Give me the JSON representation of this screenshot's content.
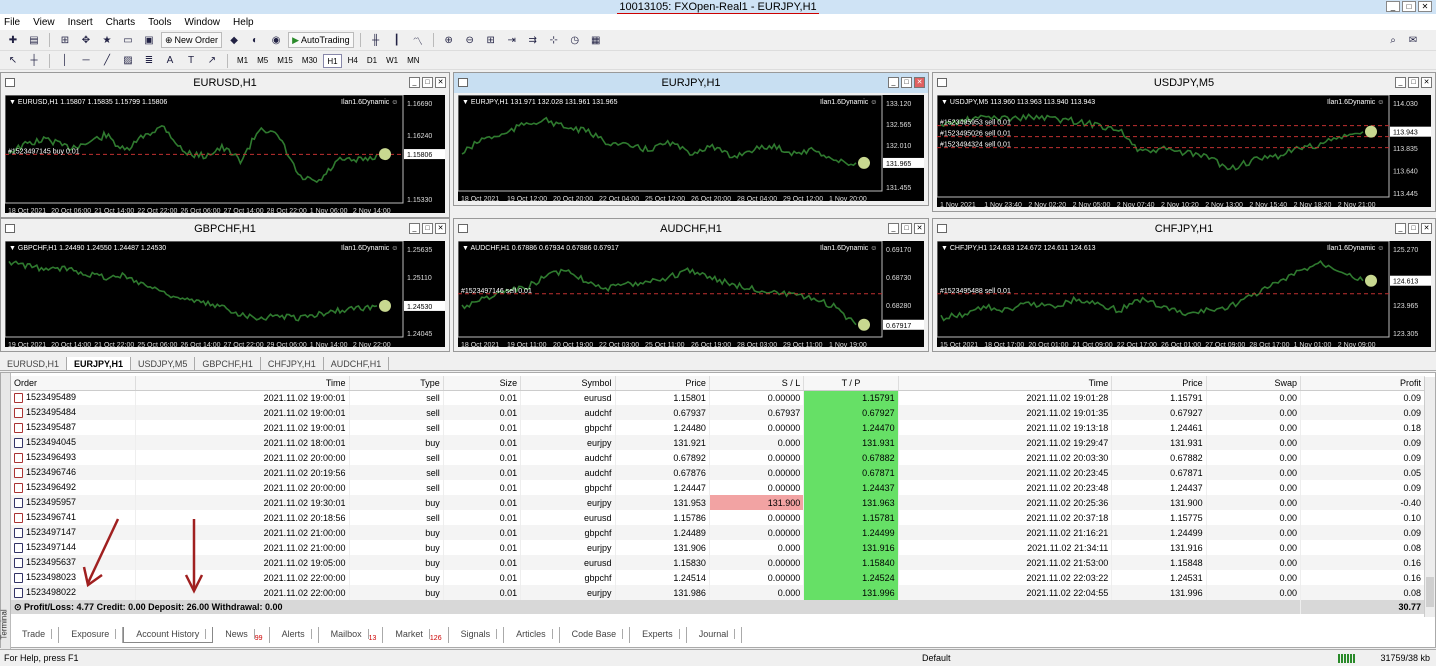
{
  "window": {
    "title": "10013105: FXOpen-Real1 - EURJPY,H1"
  },
  "menu": [
    "File",
    "View",
    "Insert",
    "Charts",
    "Tools",
    "Window",
    "Help"
  ],
  "toolbar": {
    "new_order": "New Order",
    "autotrading": "AutoTrading"
  },
  "timeframes": [
    "M1",
    "M5",
    "M15",
    "M30",
    "H1",
    "H4",
    "D1",
    "W1",
    "MN"
  ],
  "active_timeframe": "H1",
  "charts": [
    {
      "title": "EURUSD,H1",
      "info": "EURUSD,H1  1.15807 1.15835 1.15799 1.15806",
      "ea": "Ilan1.6Dynamic",
      "prices": [
        "1.16690",
        "1.16240",
        "1.15806",
        "1.15330"
      ],
      "current": "1.15806",
      "order_lines": [
        "#1523497145 buy 0.01"
      ],
      "dates": [
        "18 Oct 2021",
        "20 Oct 06:00",
        "21 Oct 14:00",
        "22 Oct 22:00",
        "26 Oct 06:00",
        "27 Oct 14:00",
        "28 Oct 22:00",
        "1 Nov 06:00",
        "2 Nov 14:00"
      ],
      "color": "#2f7a2f",
      "trend": [
        0.5,
        0.4,
        0.35,
        0.45,
        0.4,
        0.3,
        0.5,
        0.3,
        0.2,
        0.5,
        0.55,
        0.45,
        0.6,
        0.2,
        0.35,
        0.8,
        0.85,
        0.6,
        0.6,
        0.55
      ],
      "active": false
    },
    {
      "title": "EURJPY,H1",
      "info": "EURJPY,H1  131.971 132.028 131.961 131.965",
      "ea": "Ilan1.6Dynamic",
      "prices": [
        "133.120",
        "132.565",
        "132.010",
        "131.965",
        "131.455"
      ],
      "current": "131.965",
      "order_lines": [],
      "dates": [
        "18 Oct 2021",
        "19 Oct 12:00",
        "20 Oct 20:00",
        "22 Oct 04:00",
        "25 Oct 12:00",
        "26 Oct 20:00",
        "28 Oct 04:00",
        "29 Oct 12:00",
        "1 Nov 20:00"
      ],
      "color": "#2f7a2f",
      "trend": [
        0.6,
        0.4,
        0.35,
        0.2,
        0.15,
        0.25,
        0.3,
        0.45,
        0.5,
        0.55,
        0.45,
        0.6,
        0.5,
        0.65,
        0.55,
        0.5,
        0.6,
        0.55,
        0.7,
        0.75
      ],
      "active": true
    },
    {
      "title": "USDJPY,M5",
      "info": "USDJPY,M5  113.960 113.963 113.940 113.943",
      "ea": "Ilan1.6Dynamic",
      "prices": [
        "114.030",
        "113.943",
        "113.835",
        "113.640",
        "113.445"
      ],
      "current": "113.943",
      "order_lines": [
        "#1523495953 sell 0.01",
        "#1523495026 sell 0.01",
        "#1523494324 sell 0.01"
      ],
      "dates": [
        "1 Nov 2021",
        "1 Nov 23:40",
        "2 Nov 02:20",
        "2 Nov 05:00",
        "2 Nov 07:40",
        "2 Nov 10:20",
        "2 Nov 13:00",
        "2 Nov 15:40",
        "2 Nov 18:20",
        "2 Nov 21:00"
      ],
      "color": "#2f7a2f",
      "trend": [
        0.2,
        0.15,
        0.1,
        0.12,
        0.1,
        0.12,
        0.15,
        0.2,
        0.25,
        0.55,
        0.5,
        0.55,
        0.6,
        0.75,
        0.65,
        0.6,
        0.5,
        0.45,
        0.35,
        0.3
      ],
      "active": false
    },
    {
      "title": "GBPCHF,H1",
      "info": "GBPCHF,H1  1.24490 1.24550 1.24487 1.24530",
      "ea": "Ilan1.6Dynamic",
      "prices": [
        "1.25635",
        "1.25110",
        "1.24530",
        "1.24045"
      ],
      "current": "1.24530",
      "order_lines": [],
      "dates": [
        "19 Oct 2021",
        "20 Oct 14:00",
        "21 Oct 22:00",
        "25 Oct 06:00",
        "26 Oct 14:00",
        "27 Oct 22:00",
        "29 Oct 06:00",
        "1 Nov 14:00",
        "2 Nov 22:00"
      ],
      "color": "#2f7a2f",
      "trend": [
        0.1,
        0.15,
        0.2,
        0.18,
        0.25,
        0.3,
        0.28,
        0.4,
        0.5,
        0.6,
        0.65,
        0.7,
        0.8,
        0.85,
        0.82,
        0.85,
        0.8,
        0.75,
        0.72,
        0.7
      ],
      "active": false
    },
    {
      "title": "AUDCHF,H1",
      "info": "AUDCHF,H1  0.67886 0.67934 0.67886 0.67917",
      "ea": "Ilan1.6Dynamic",
      "prices": [
        "0.69170",
        "0.68730",
        "0.68280",
        "0.67917"
      ],
      "current": "0.67917",
      "order_lines": [
        "#1523497146 sell 0.01"
      ],
      "dates": [
        "18 Oct 2021",
        "19 Oct 11:00",
        "20 Oct 19:00",
        "22 Oct 03:00",
        "25 Oct 11:00",
        "26 Oct 19:00",
        "28 Oct 03:00",
        "29 Oct 11:00",
        "1 Nov 19:00"
      ],
      "color": "#2f7a2f",
      "trend": [
        0.7,
        0.6,
        0.5,
        0.45,
        0.3,
        0.2,
        0.35,
        0.45,
        0.4,
        0.35,
        0.3,
        0.2,
        0.3,
        0.4,
        0.45,
        0.5,
        0.55,
        0.6,
        0.7,
        0.95
      ],
      "active": false
    },
    {
      "title": "CHFJPY,H1",
      "info": "CHFJPY,H1  124.633 124.672 124.611 124.613",
      "ea": "Ilan1.6Dynamic",
      "prices": [
        "125.270",
        "124.613",
        "123.965",
        "123.305"
      ],
      "current": "124.613",
      "order_lines": [
        "#1523495488 sell 0.01"
      ],
      "dates": [
        "15 Oct 2021",
        "18 Oct 17:00",
        "20 Oct 01:00",
        "21 Oct 09:00",
        "22 Oct 17:00",
        "26 Oct 01:00",
        "27 Oct 09:00",
        "28 Oct 17:00",
        "1 Nov 01:00",
        "2 Nov 09:00"
      ],
      "color": "#2f7a2f",
      "trend": [
        0.85,
        0.8,
        0.7,
        0.75,
        0.65,
        0.7,
        0.6,
        0.65,
        0.75,
        0.6,
        0.7,
        0.8,
        0.75,
        0.7,
        0.55,
        0.4,
        0.25,
        0.1,
        0.2,
        0.35
      ],
      "active": false
    }
  ],
  "chart_tabs": [
    "EURUSD,H1",
    "EURJPY,H1",
    "USDJPY,M5",
    "GBPCHF,H1",
    "CHFJPY,H1",
    "AUDCHF,H1"
  ],
  "active_chart_tab": "EURJPY,H1",
  "table": {
    "headers": [
      "Order",
      "Time",
      "Type",
      "Size",
      "Symbol",
      "Price",
      "S / L",
      "T / P",
      "Time",
      "Price",
      "Swap",
      "Profit"
    ],
    "rows": [
      [
        "1523495489",
        "2021.11.02 19:00:01",
        "sell",
        "0.01",
        "eurusd",
        "1.15801",
        "0.00000",
        "1.15791",
        "2021.11.02 19:01:28",
        "1.15791",
        "0.00",
        "0.09"
      ],
      [
        "1523495484",
        "2021.11.02 19:00:01",
        "sell",
        "0.01",
        "audchf",
        "0.67937",
        "0.67937",
        "0.67927",
        "2021.11.02 19:01:35",
        "0.67927",
        "0.00",
        "0.09"
      ],
      [
        "1523495487",
        "2021.11.02 19:00:01",
        "sell",
        "0.01",
        "gbpchf",
        "1.24480",
        "0.00000",
        "1.24470",
        "2021.11.02 19:13:18",
        "1.24461",
        "0.00",
        "0.18"
      ],
      [
        "1523494045",
        "2021.11.02 18:00:01",
        "buy",
        "0.01",
        "eurjpy",
        "131.921",
        "0.000",
        "131.931",
        "2021.11.02 19:29:47",
        "131.931",
        "0.00",
        "0.09"
      ],
      [
        "1523496493",
        "2021.11.02 20:00:00",
        "sell",
        "0.01",
        "audchf",
        "0.67892",
        "0.00000",
        "0.67882",
        "2021.11.02 20:03:30",
        "0.67882",
        "0.00",
        "0.09"
      ],
      [
        "1523496746",
        "2021.11.02 20:19:56",
        "sell",
        "0.01",
        "audchf",
        "0.67876",
        "0.00000",
        "0.67871",
        "2021.11.02 20:23:45",
        "0.67871",
        "0.00",
        "0.05"
      ],
      [
        "1523496492",
        "2021.11.02 20:00:00",
        "sell",
        "0.01",
        "gbpchf",
        "1.24447",
        "0.00000",
        "1.24437",
        "2021.11.02 20:23:48",
        "1.24437",
        "0.00",
        "0.09"
      ],
      [
        "1523495957",
        "2021.11.02 19:30:01",
        "buy",
        "0.01",
        "eurjpy",
        "131.953",
        "131.900",
        "131.963",
        "2021.11.02 20:25:36",
        "131.900",
        "0.00",
        "-0.40"
      ],
      [
        "1523496741",
        "2021.11.02 20:18:56",
        "sell",
        "0.01",
        "eurusd",
        "1.15786",
        "0.00000",
        "1.15781",
        "2021.11.02 20:37:18",
        "1.15775",
        "0.00",
        "0.10"
      ],
      [
        "1523497147",
        "2021.11.02 21:00:00",
        "buy",
        "0.01",
        "gbpchf",
        "1.24489",
        "0.00000",
        "1.24499",
        "2021.11.02 21:16:21",
        "1.24499",
        "0.00",
        "0.09"
      ],
      [
        "1523497144",
        "2021.11.02 21:00:00",
        "buy",
        "0.01",
        "eurjpy",
        "131.906",
        "0.000",
        "131.916",
        "2021.11.02 21:34:11",
        "131.916",
        "0.00",
        "0.08"
      ],
      [
        "1523495637",
        "2021.11.02 19:05:00",
        "buy",
        "0.01",
        "eurusd",
        "1.15830",
        "0.00000",
        "1.15840",
        "2021.11.02 21:53:00",
        "1.15848",
        "0.00",
        "0.16"
      ],
      [
        "1523498023",
        "2021.11.02 22:00:00",
        "buy",
        "0.01",
        "gbpchf",
        "1.24514",
        "0.00000",
        "1.24524",
        "2021.11.02 22:03:22",
        "1.24531",
        "0.00",
        "0.16"
      ],
      [
        "1523498022",
        "2021.11.02 22:00:00",
        "buy",
        "0.01",
        "eurjpy",
        "131.986",
        "0.000",
        "131.996",
        "2021.11.02 22:04:55",
        "131.996",
        "0.00",
        "0.08"
      ]
    ],
    "summary": "Profit/Loss: 4.77  Credit: 0.00  Deposit: 26.00  Withdrawal: 0.00",
    "total": "30.77"
  },
  "terminal_label": "Terminal",
  "bottom_tabs": [
    {
      "label": "Trade",
      "badge": ""
    },
    {
      "label": "Exposure",
      "badge": ""
    },
    {
      "label": "Account History",
      "badge": ""
    },
    {
      "label": "News",
      "badge": "99"
    },
    {
      "label": "Alerts",
      "badge": ""
    },
    {
      "label": "Mailbox",
      "badge": "13"
    },
    {
      "label": "Market",
      "badge": "126"
    },
    {
      "label": "Signals",
      "badge": ""
    },
    {
      "label": "Articles",
      "badge": ""
    },
    {
      "label": "Code Base",
      "badge": ""
    },
    {
      "label": "Experts",
      "badge": ""
    },
    {
      "label": "Journal",
      "badge": ""
    }
  ],
  "active_bottom_tab": "Account History",
  "status": {
    "help": "For Help, press F1",
    "profile": "Default",
    "traffic": "31759/38 kb"
  }
}
